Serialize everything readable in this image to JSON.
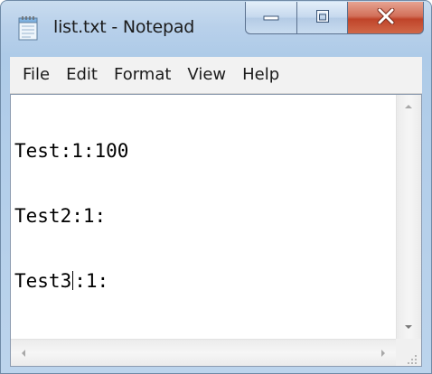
{
  "window": {
    "title": "list.txt - Notepad",
    "app_icon": "notepad-icon",
    "caption_icons": {
      "minimize": "minimize-icon",
      "maximize": "maximize-icon",
      "close": "close-icon"
    },
    "colors": {
      "frame": "#b8d0ea",
      "close_button": "#c7503a"
    }
  },
  "menubar": {
    "items": [
      {
        "label": "File"
      },
      {
        "label": "Edit"
      },
      {
        "label": "Format"
      },
      {
        "label": "View"
      },
      {
        "label": "Help"
      }
    ]
  },
  "editor": {
    "lines": [
      {
        "text": "Test:1:100"
      },
      {
        "text": "Test2:1:"
      },
      {
        "before_caret": "Test3",
        "after_caret": ":1:"
      }
    ]
  }
}
